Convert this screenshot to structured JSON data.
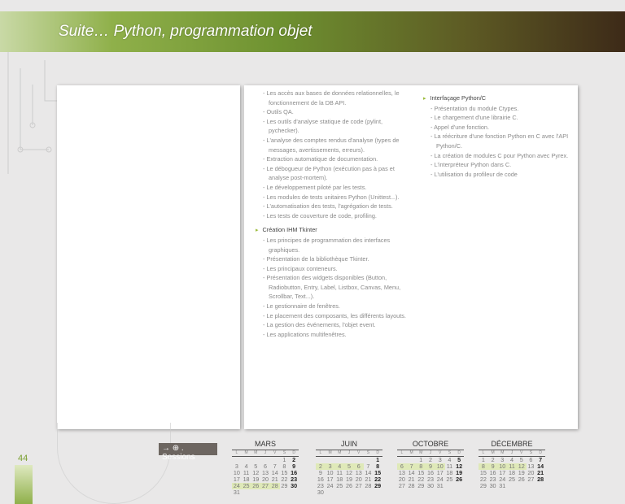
{
  "header": {
    "title": "Suite… Python, programmation objet"
  },
  "page_number": "44",
  "sessions_label": "→ ⊕ . Sessions",
  "col1": [
    {
      "type": "item",
      "text": "Les accès aux bases de données relationnelles, le fonctionnement de la DB API."
    },
    {
      "type": "item",
      "text": "Outils QA."
    },
    {
      "type": "item",
      "text": "Les outils d'analyse statique de code (pylint, pychecker)."
    },
    {
      "type": "item",
      "text": "L'analyse des comptes rendus d'analyse (types de messages, avertissements, erreurs)."
    },
    {
      "type": "item",
      "text": "Extraction automatique de documentation."
    },
    {
      "type": "item",
      "text": "Le débogueur de Python (exécution pas à pas et analyse post-mortem)."
    },
    {
      "type": "item",
      "text": "Le développement piloté par les tests."
    },
    {
      "type": "item",
      "text": "Les modules de tests unitaires Python (Unittest...)."
    },
    {
      "type": "item",
      "text": "L'automatisation des tests, l'agrégation de tests."
    },
    {
      "type": "item",
      "text": "Les tests de couverture de code, profiling."
    },
    {
      "type": "sec",
      "text": "Création IHM Tkinter"
    },
    {
      "type": "item",
      "text": "Les principes de programmation des interfaces graphiques."
    },
    {
      "type": "item",
      "text": "Présentation de la bibliothèque Tkinter."
    },
    {
      "type": "item",
      "text": "Les principaux conteneurs."
    },
    {
      "type": "item",
      "text": "Présentation des widgets disponibles (Button, Radiobutton, Entry, Label, Listbox, Canvas, Menu, Scrollbar, Text...)."
    },
    {
      "type": "item",
      "text": "Le gestionnaire de fenêtres."
    },
    {
      "type": "item",
      "text": "Le placement des composants, les différents layouts."
    },
    {
      "type": "item",
      "text": "La gestion des événements, l'objet event."
    },
    {
      "type": "item",
      "text": "Les applications multifenêtres."
    }
  ],
  "col2": [
    {
      "type": "sec",
      "text": "Interfaçage Python/C"
    },
    {
      "type": "item",
      "text": "Présentation du module Ctypes."
    },
    {
      "type": "item",
      "text": "Le chargement d'une librairie C."
    },
    {
      "type": "item",
      "text": "Appel d'une fonction."
    },
    {
      "type": "item",
      "text": "La réécriture d'une fonction Python en C avec l'API Python/C."
    },
    {
      "type": "item",
      "text": "La création de modules C pour Python avec Pyrex."
    },
    {
      "type": "item",
      "text": "L'interpréteur Python dans C."
    },
    {
      "type": "item",
      "text": "L'utilisation du profileur de code"
    }
  ],
  "weekdays": [
    "L",
    "M",
    "M",
    "J",
    "V",
    "S",
    "D"
  ],
  "calendars": [
    {
      "month": "MARS",
      "start": 5,
      "days": 31,
      "highlight": [
        24,
        28
      ]
    },
    {
      "month": "JUIN",
      "start": 6,
      "days": 30,
      "highlight": [
        2,
        6
      ]
    },
    {
      "month": "OCTOBRE",
      "start": 2,
      "days": 31,
      "highlight": [
        6,
        10
      ]
    },
    {
      "month": "DÉCEMBRE",
      "start": 0,
      "days": 31,
      "highlight": [
        8,
        12
      ]
    }
  ],
  "colors": {
    "accent": "#9cbc3c",
    "highlight": "#dfe9b8"
  }
}
